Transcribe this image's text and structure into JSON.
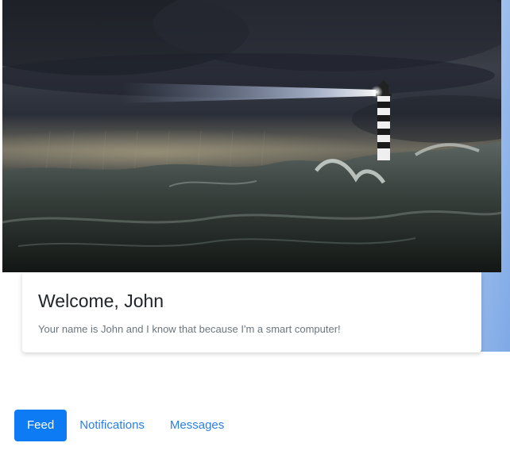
{
  "hero": {
    "image_subject": "lighthouse-in-storm"
  },
  "welcome_card": {
    "title": "Welcome, John",
    "text": "Your name is John and I know that because I'm a smart computer!"
  },
  "nav": {
    "active_index": 0,
    "tabs": [
      {
        "label": "Feed"
      },
      {
        "label": "Notifications"
      },
      {
        "label": "Messages"
      }
    ]
  },
  "colors": {
    "accent": "#0d7bf4",
    "link": "#2b7de9"
  }
}
